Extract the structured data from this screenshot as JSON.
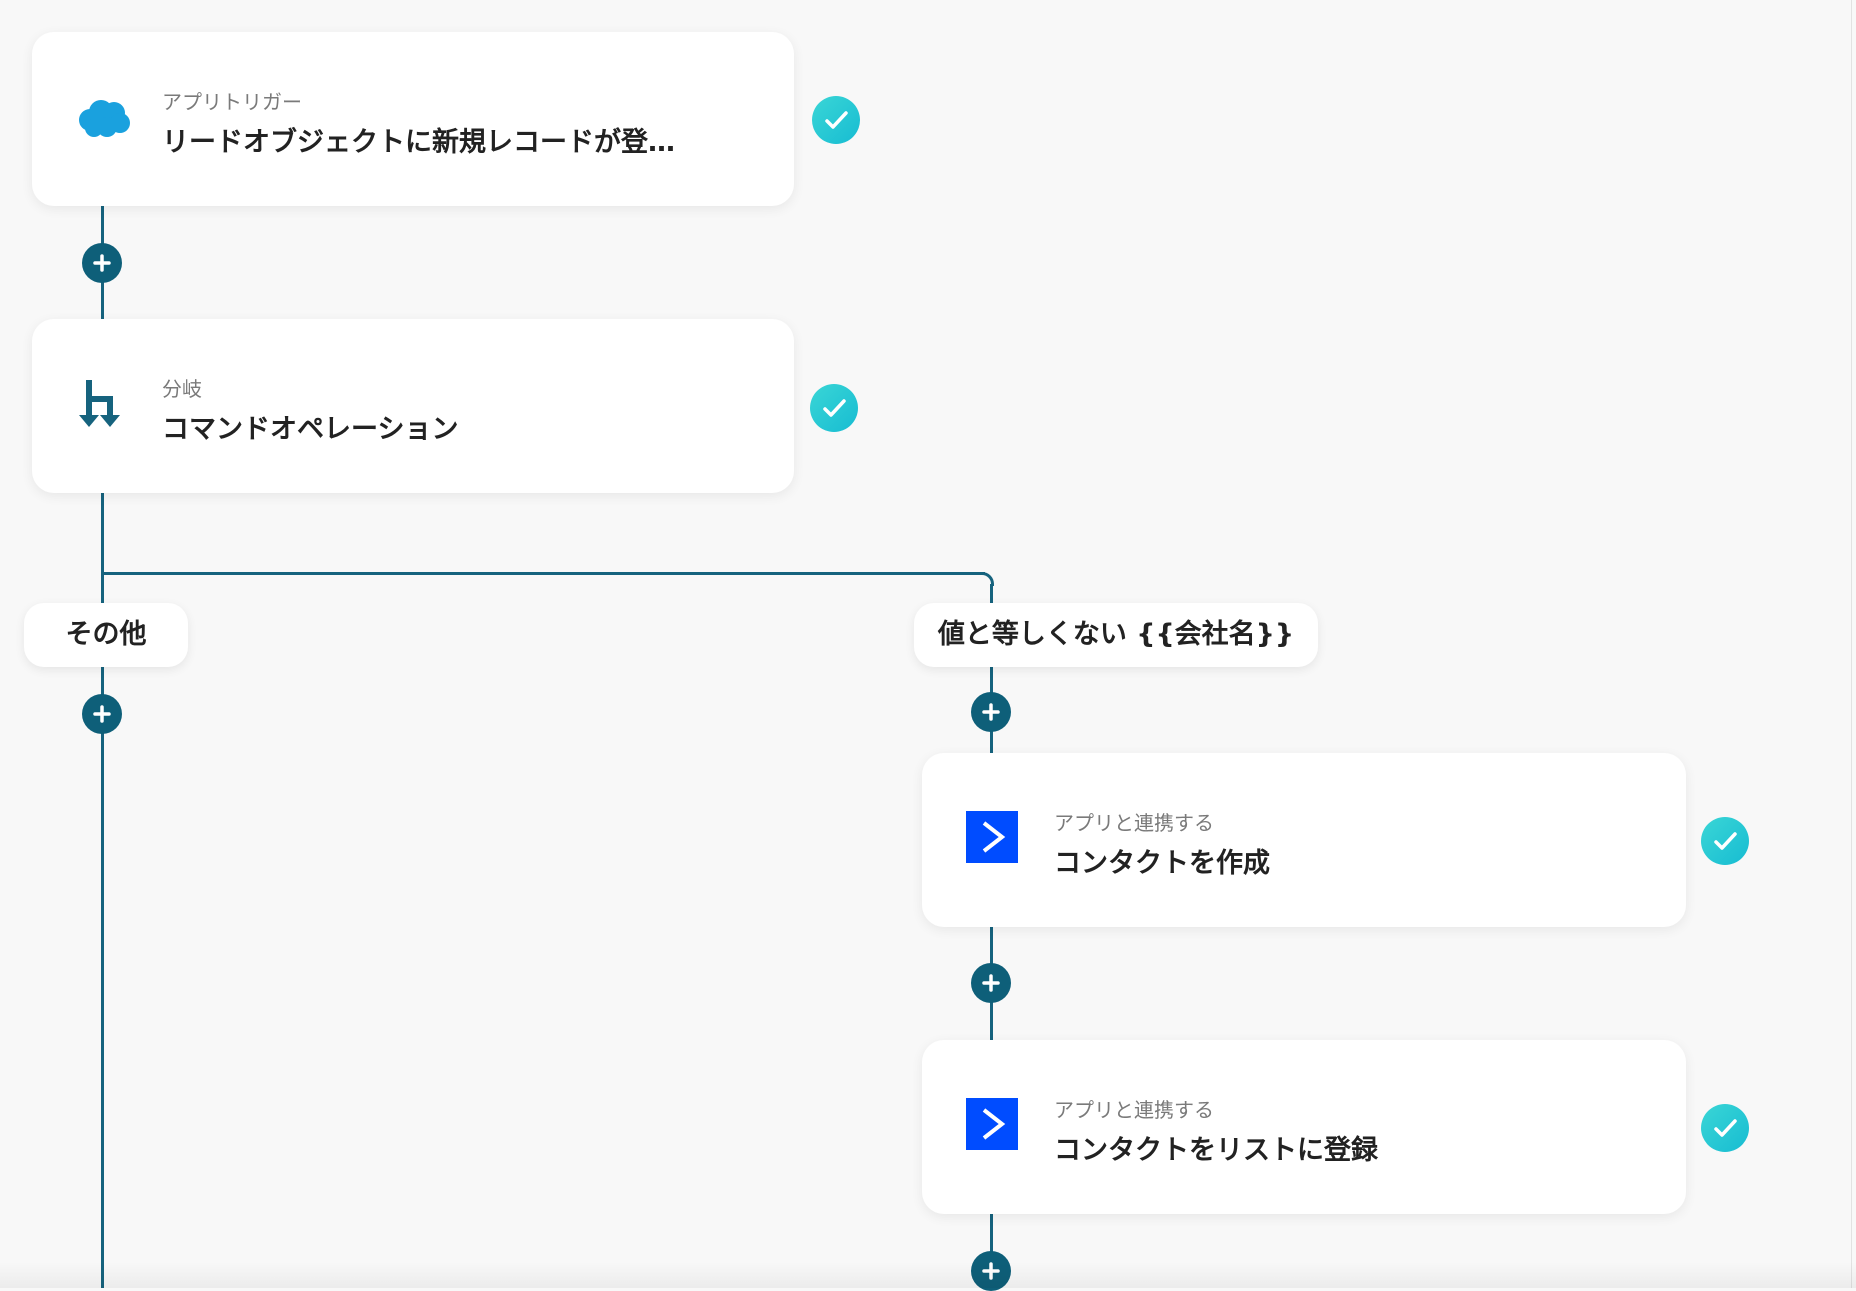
{
  "colors": {
    "line": "#16637e",
    "plus": "#0e5f79",
    "check": "#1fc6d4",
    "activecampaign": "#004cff",
    "salesforce": "#1aa1de"
  },
  "steps": [
    {
      "subtitle": "アプリトリガー",
      "title": "リードオブジェクトに新規レコードが登…",
      "icon": "salesforce-cloud-icon"
    },
    {
      "subtitle": "分岐",
      "title": "コマンドオペレーション",
      "icon": "branch-icon"
    },
    {
      "subtitle": "アプリと連携する",
      "title": "コンタクトを作成",
      "icon": "activecampaign-icon"
    },
    {
      "subtitle": "アプリと連携する",
      "title": "コンタクトをリストに登録",
      "icon": "activecampaign-icon"
    }
  ],
  "branches": [
    {
      "label": "その他"
    },
    {
      "label": "値と等しくない {{会社名}}"
    }
  ]
}
